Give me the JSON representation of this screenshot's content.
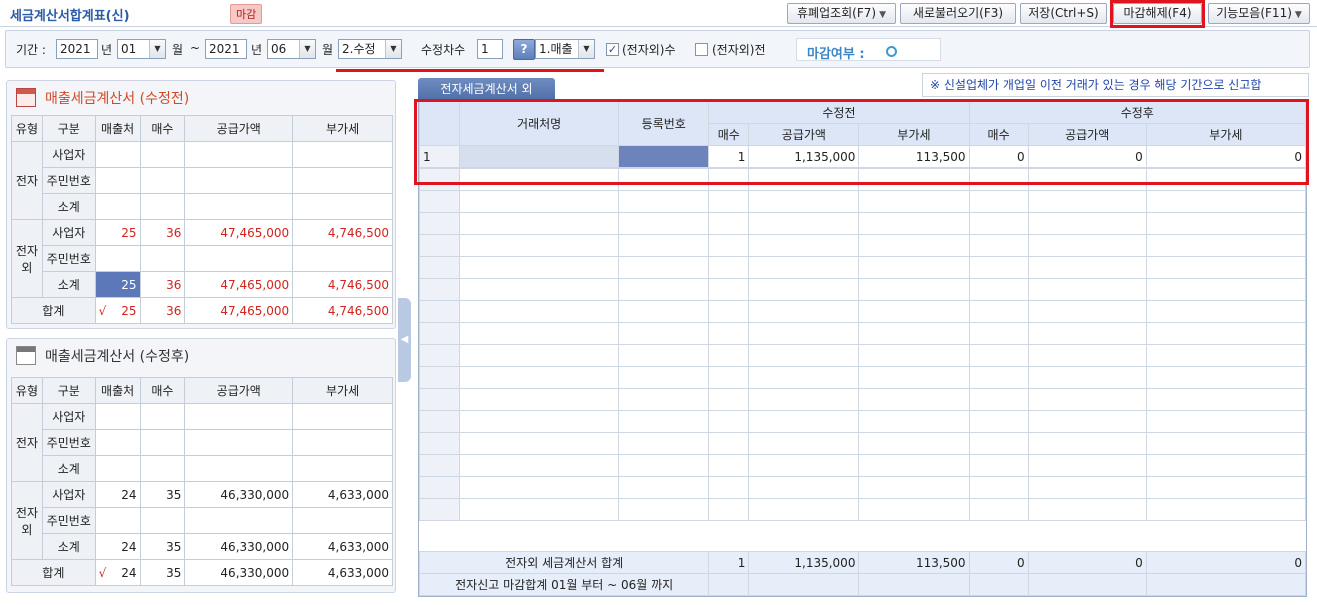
{
  "app": {
    "title": "세금계산서합계표(신)",
    "badge": "마감"
  },
  "toolbar": [
    {
      "label": "휴폐업조회(F7)",
      "dropdown": true
    },
    {
      "label": "새로불러오기(F3)",
      "dropdown": false
    },
    {
      "label": "저장(Ctrl+S)",
      "dropdown": false
    },
    {
      "label": "마감해제(F4)",
      "dropdown": false
    },
    {
      "label": "기능모음(F11)",
      "dropdown": true
    }
  ],
  "filter": {
    "period_label": "기간 :",
    "from_year": "2021",
    "year_unit": "년",
    "from_month": "01",
    "month_unit": "월",
    "tilde": "~",
    "to_year": "2021",
    "to_month": "06",
    "kind": "2.수정",
    "rev_count_label": "수정차수",
    "rev_count": "1",
    "help": "?",
    "sale_type": "1.매출",
    "chk1_checked": true,
    "chk1_label": "(전자외)수",
    "chk2_checked": false,
    "chk2_label": "(전자외)전",
    "closing_label": "마감여부 :"
  },
  "panel_before": {
    "title": "매출세금계산서 (수정전)",
    "headers": [
      "유형",
      "구분",
      "매출처",
      "매수",
      "공급가액",
      "부가세"
    ],
    "group1": "전자",
    "group2": "전자외",
    "rows": [
      {
        "label": "사업자",
        "c": "",
        "n": "",
        "amt": "",
        "vat": ""
      },
      {
        "label": "주민번호",
        "c": "",
        "n": "",
        "amt": "",
        "vat": ""
      },
      {
        "label": "소계",
        "c": "",
        "n": "",
        "amt": "",
        "vat": ""
      },
      {
        "label": "사업자",
        "c": "25",
        "n": "36",
        "amt": "47,465,000",
        "vat": "4,746,500"
      },
      {
        "label": "주민번호",
        "c": "",
        "n": "",
        "amt": "",
        "vat": ""
      },
      {
        "label": "소계",
        "c": "25",
        "n": "36",
        "amt": "47,465,000",
        "vat": "4,746,500"
      }
    ],
    "total": {
      "label": "합계",
      "mark": "√",
      "c": "25",
      "n": "36",
      "amt": "47,465,000",
      "vat": "4,746,500"
    }
  },
  "panel_after": {
    "title": "매출세금계산서 (수정후)",
    "headers": [
      "유형",
      "구분",
      "매출처",
      "매수",
      "공급가액",
      "부가세"
    ],
    "group1": "전자",
    "group2": "전자외",
    "rows": [
      {
        "label": "사업자",
        "c": "",
        "n": "",
        "amt": "",
        "vat": ""
      },
      {
        "label": "주민번호",
        "c": "",
        "n": "",
        "amt": "",
        "vat": ""
      },
      {
        "label": "소계",
        "c": "",
        "n": "",
        "amt": "",
        "vat": ""
      },
      {
        "label": "사업자",
        "c": "24",
        "n": "35",
        "amt": "46,330,000",
        "vat": "4,633,000"
      },
      {
        "label": "주민번호",
        "c": "",
        "n": "",
        "amt": "",
        "vat": ""
      },
      {
        "label": "소계",
        "c": "24",
        "n": "35",
        "amt": "46,330,000",
        "vat": "4,633,000"
      }
    ],
    "total": {
      "label": "합계",
      "mark": "√",
      "c": "24",
      "n": "35",
      "amt": "46,330,000",
      "vat": "4,633,000"
    }
  },
  "grid": {
    "tab": "전자세금계산서 외",
    "notice": "※ 신설업체가 개업일 이전 거래가 있는 경우 해당 기간으로 신고합",
    "h_name": "거래처명",
    "h_reg": "등록번호",
    "h_before": "수정전",
    "h_after": "수정후",
    "h_cnt": "매수",
    "h_amt": "공급가액",
    "h_vat": "부가세",
    "row1": {
      "no": "1",
      "bc": "1",
      "ba": "1,135,000",
      "bv": "113,500",
      "ac": "0",
      "aa": "0",
      "av": "0"
    },
    "sum": {
      "label": "전자외 세금계산서 합계",
      "bc": "1",
      "ba": "1,135,000",
      "bv": "113,500",
      "ac": "0",
      "aa": "0",
      "av": "0"
    },
    "total_label": "전자신고 마감합계 01월 부터 ~ 06월 까지"
  }
}
